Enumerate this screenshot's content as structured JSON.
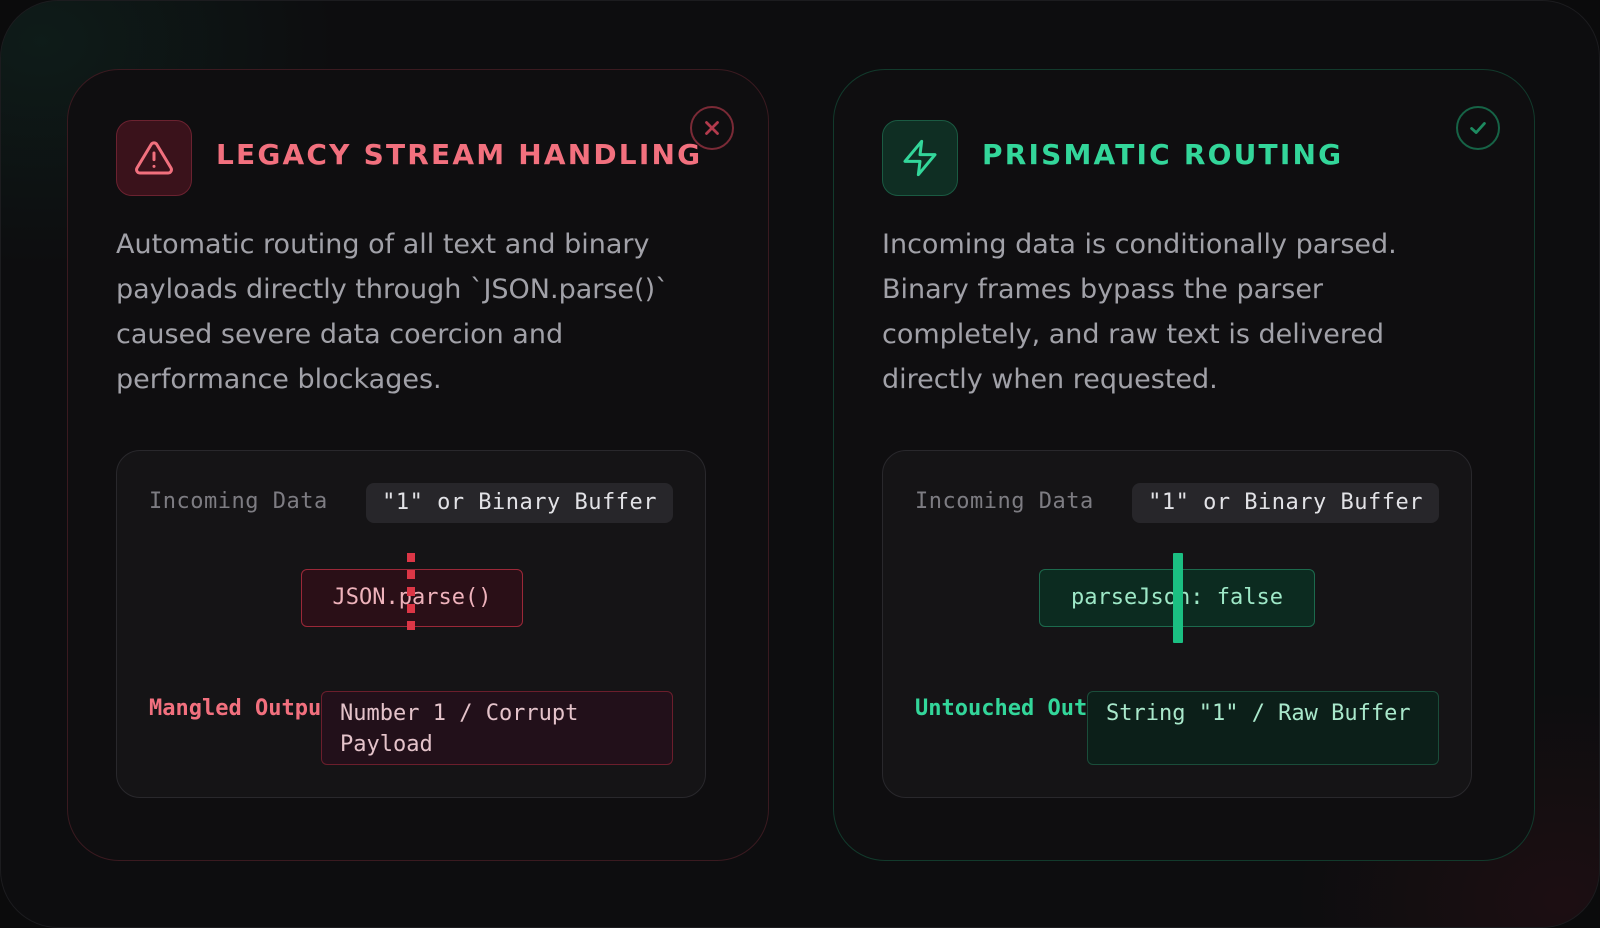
{
  "colors": {
    "legacy_accent": "#f2707e",
    "prism_accent": "#33d69a",
    "background": "#0d0d0f"
  },
  "legacy": {
    "title": "LEGACY STREAM HANDLING",
    "icon": "warning-triangle-icon",
    "status_icon": "close-circle-icon",
    "description": "Automatic routing of all text and binary payloads directly through `JSON.parse()` caused severe data coercion and performance blockages.",
    "incoming_label": "Incoming Data",
    "incoming_value": "\"1\" or Binary Buffer",
    "processor": "JSON.parse()",
    "output_label": "Mangled Output",
    "output_value": "Number 1 / Corrupt Payload"
  },
  "prism": {
    "title": "PRISMATIC ROUTING",
    "icon": "lightning-bolt-icon",
    "status_icon": "check-circle-icon",
    "description": "Incoming data is conditionally parsed. Binary frames bypass the parser completely, and raw text is delivered directly when requested.",
    "incoming_label": "Incoming Data",
    "incoming_value": "\"1\" or Binary Buffer",
    "processor": "parseJson: false",
    "output_label": "Untouched Output",
    "output_value": "String \"1\" / Raw Buffer"
  }
}
